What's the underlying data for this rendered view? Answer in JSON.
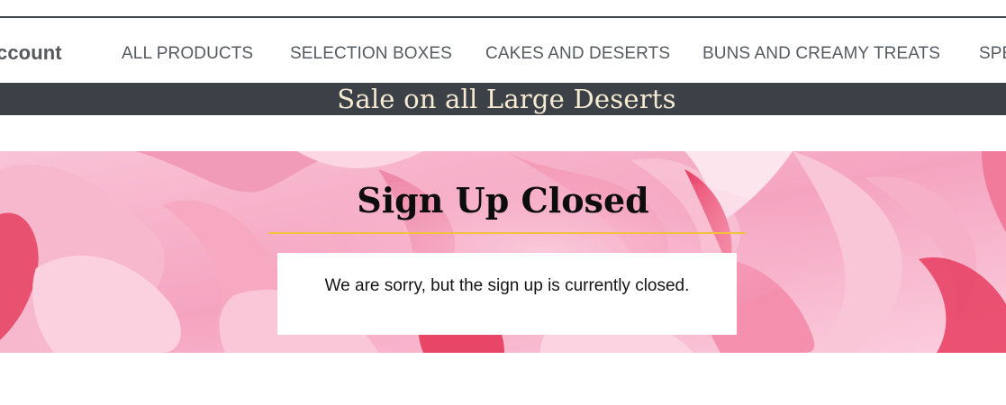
{
  "nav": {
    "items": [
      {
        "label": "ccount"
      },
      {
        "label": "ALL PRODUCTS"
      },
      {
        "label": "SELECTION BOXES"
      },
      {
        "label": "CAKES AND DESERTS"
      },
      {
        "label": "BUNS AND CREAMY TREATS"
      },
      {
        "label": "SPE"
      }
    ]
  },
  "banner": {
    "text": "Sale on all Large Deserts",
    "background": "#3b4147",
    "text_color": "#f6ead2"
  },
  "hero": {
    "title": "Sign Up Closed",
    "message": "We are sorry, but the sign up is currently closed.",
    "underline_color": "#f2c23a",
    "background_description_color": "#f4a9c2"
  }
}
